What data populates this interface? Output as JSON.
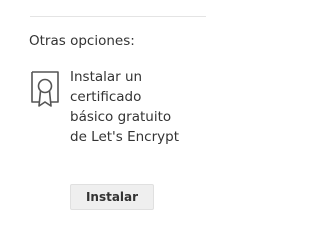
{
  "other_options": {
    "title": "Otras opciones:",
    "option": {
      "icon": "certificate-icon",
      "description": "Instalar un\ncertificado\nbásico gratuito\nde Let's Encrypt",
      "button_label": "Instalar"
    }
  },
  "colors": {
    "text": "#333333",
    "button_background": "#efefef",
    "divider": "#e4e4e4",
    "icon_stroke": "#555555"
  }
}
